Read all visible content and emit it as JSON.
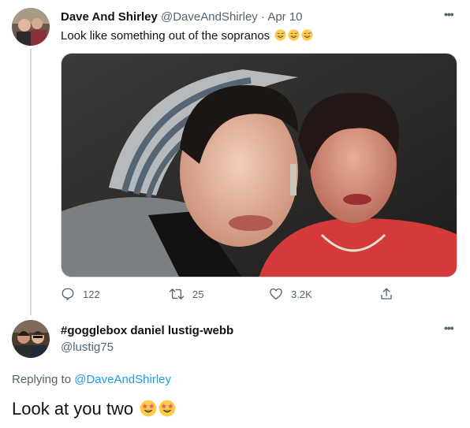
{
  "tweet": {
    "display_name": "Dave And Shirley",
    "handle": "@DaveAndShirley",
    "separator": "·",
    "date": "Apr 10",
    "text": "Look like something out of the sopranos",
    "emoji_icon": "sweat-smile-emoji",
    "emoji_count": 3,
    "stats": {
      "replies": "122",
      "retweets": "25",
      "likes": "3.2K"
    }
  },
  "reply": {
    "display_name": "#gogglebox daniel lustig-webb",
    "handle": "@lustig75",
    "replying_prefix": "Replying to",
    "replying_to": "@DaveAndShirley",
    "text": "Look at you two",
    "emoji_icon": "star-struck-emoji",
    "emoji_count": 2
  },
  "more_icon": "•••",
  "colors": {
    "text": "#0f1419",
    "secondary": "#536471",
    "link": "#1d9bf0",
    "thread_line": "#cfd9de"
  }
}
